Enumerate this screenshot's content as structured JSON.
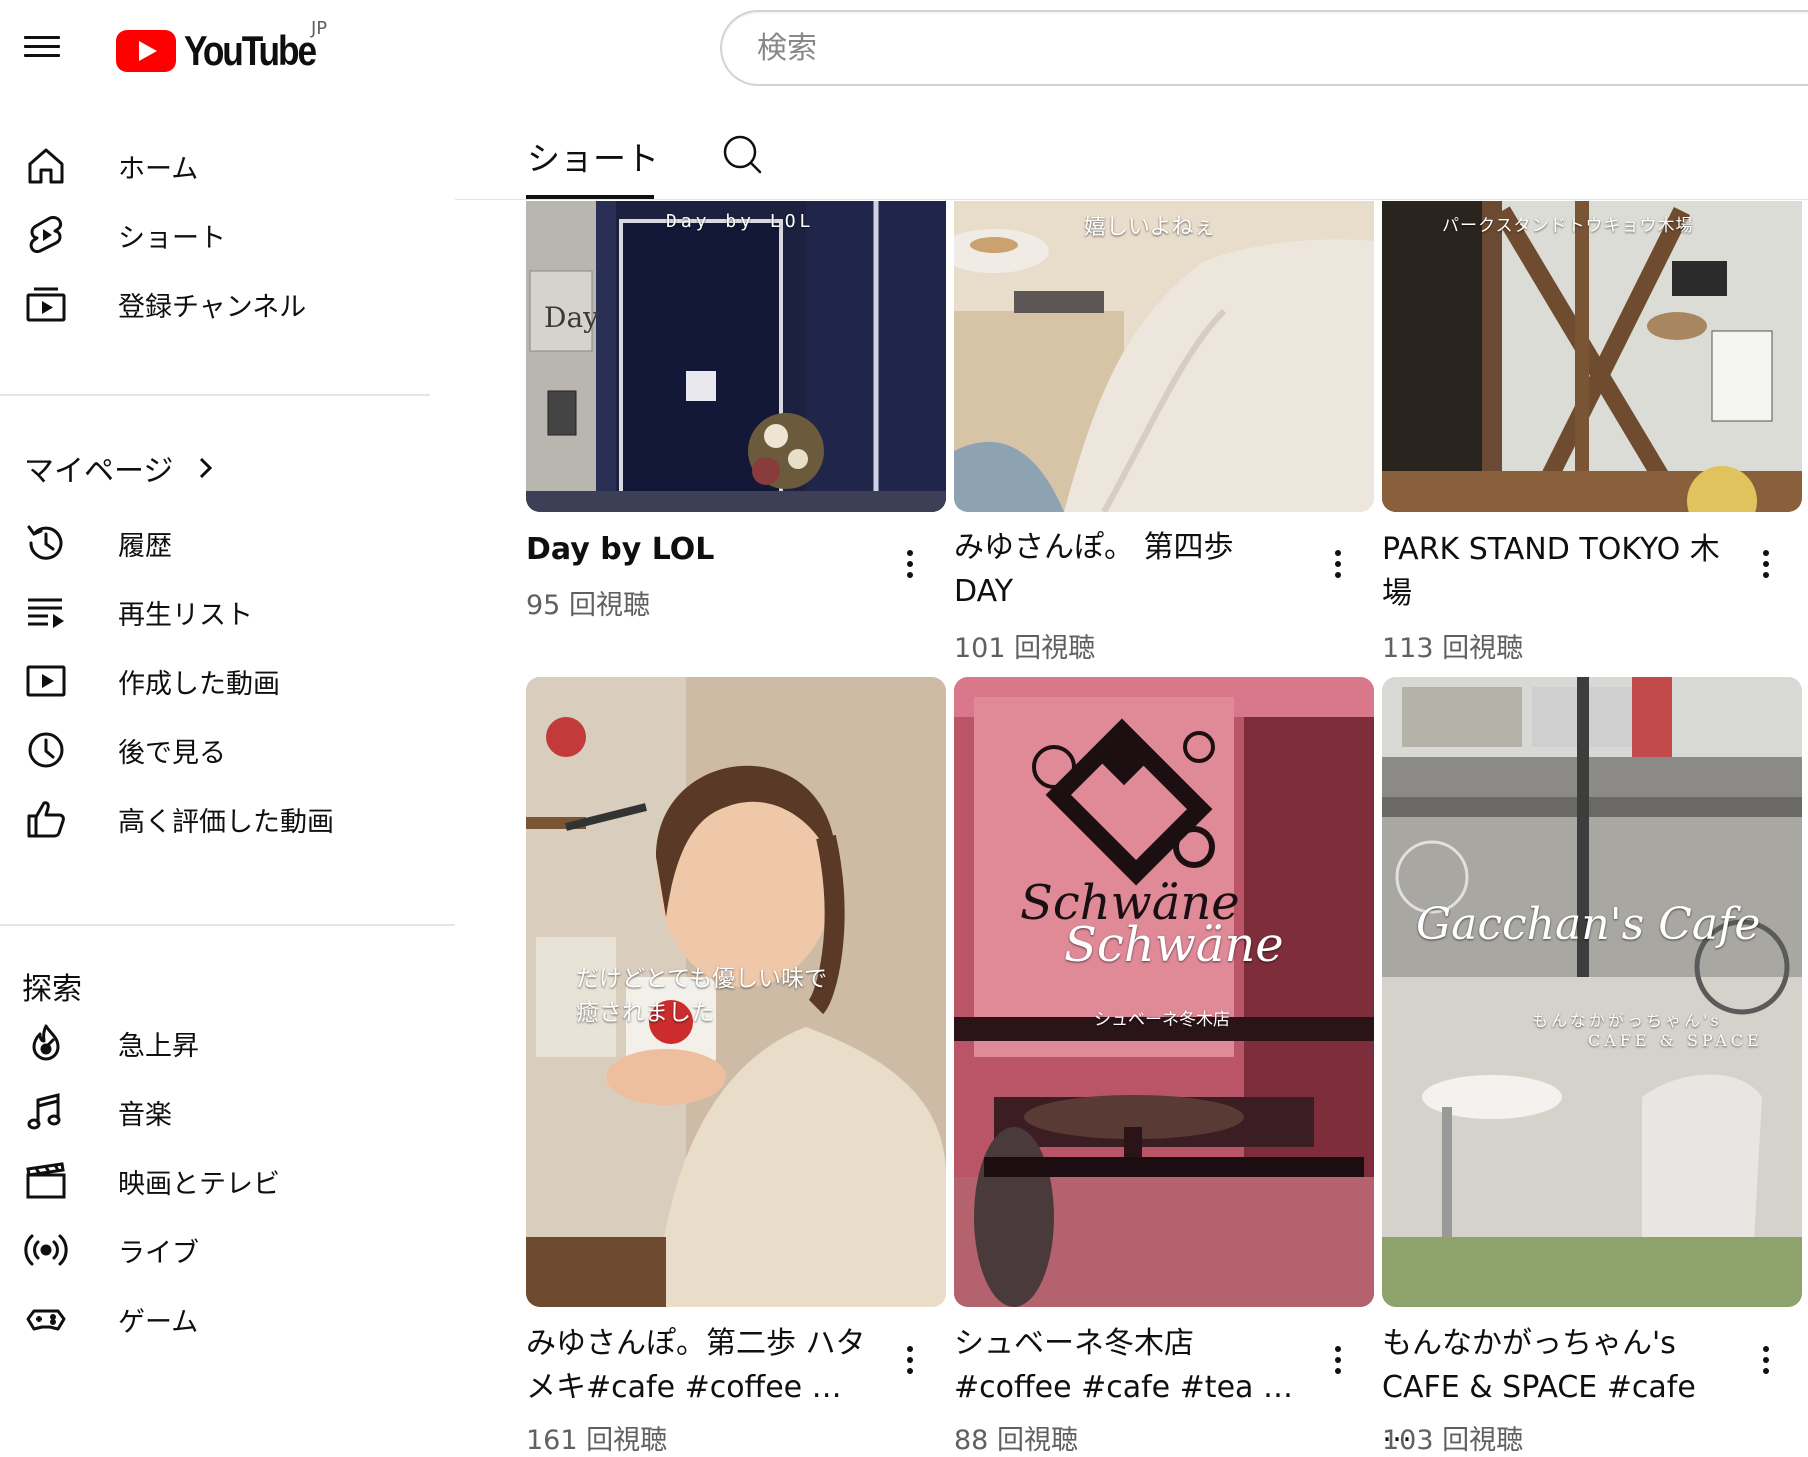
{
  "topbar": {
    "logo_text": "YouTube",
    "region": "JP",
    "search_placeholder": "検索"
  },
  "sidebar": {
    "main": [
      {
        "label": "ホーム",
        "icon": "home-icon"
      },
      {
        "label": "ショート",
        "icon": "shorts-icon"
      },
      {
        "label": "登録チャンネル",
        "icon": "subscriptions-icon"
      }
    ],
    "you_title": "マイページ",
    "you": [
      {
        "label": "履歴",
        "icon": "history-icon"
      },
      {
        "label": "再生リスト",
        "icon": "playlist-icon"
      },
      {
        "label": "作成した動画",
        "icon": "your-videos-icon"
      },
      {
        "label": "後で見る",
        "icon": "watch-later-icon"
      },
      {
        "label": "高く評価した動画",
        "icon": "liked-icon"
      }
    ],
    "explore_title": "探索",
    "explore": [
      {
        "label": "急上昇",
        "icon": "trending-icon"
      },
      {
        "label": "音楽",
        "icon": "music-icon"
      },
      {
        "label": "映画とテレビ",
        "icon": "movies-icon"
      },
      {
        "label": "ライブ",
        "icon": "live-icon"
      },
      {
        "label": "ゲーム",
        "icon": "gaming-icon"
      }
    ]
  },
  "tabs": {
    "active": "ショート",
    "search_icon": "search-icon"
  },
  "videos": [
    {
      "title": "Day  by  LOL",
      "views": "95 回視聴",
      "overlay": "Day  by  LOL",
      "sign": "Day"
    },
    {
      "title": "みゆさんぽ。 第四歩 DAY",
      "views": "101 回視聴",
      "overlay": "嬉しいよねぇ"
    },
    {
      "title": "PARK STAND TOKYO 木場",
      "views": "113 回視聴",
      "overlay": "パークスタンドトウキョウ木場"
    },
    {
      "title": "みゆさんぽ。第二歩 ハタメキ#cafe #coffee …",
      "views": "161 回視聴",
      "overlay_line1": "だけどとても優しい味で",
      "overlay_line2": "癒されました"
    },
    {
      "title": "シュベーネ冬木店 #coffee #cafe #tea …",
      "views": "88 回視聴",
      "overlay_line1": "Schwäne",
      "overlay_line2": "Schwäne",
      "overlay_line3": "シュベーネ冬木店"
    },
    {
      "title": "もんなかがっちゃん's CAFE & SPACE  #cafe …",
      "views": "103 回視聴",
      "overlay_line1": "Gacchan's Cafe",
      "overlay_line2": "もんなかがっちゃん's",
      "overlay_line3": "CAFE & SPACE"
    }
  ],
  "colors": {
    "brand_red": "#ff0000",
    "text_primary": "#0f0f0f",
    "text_secondary": "#606060",
    "divider": "#e5e5e5"
  }
}
